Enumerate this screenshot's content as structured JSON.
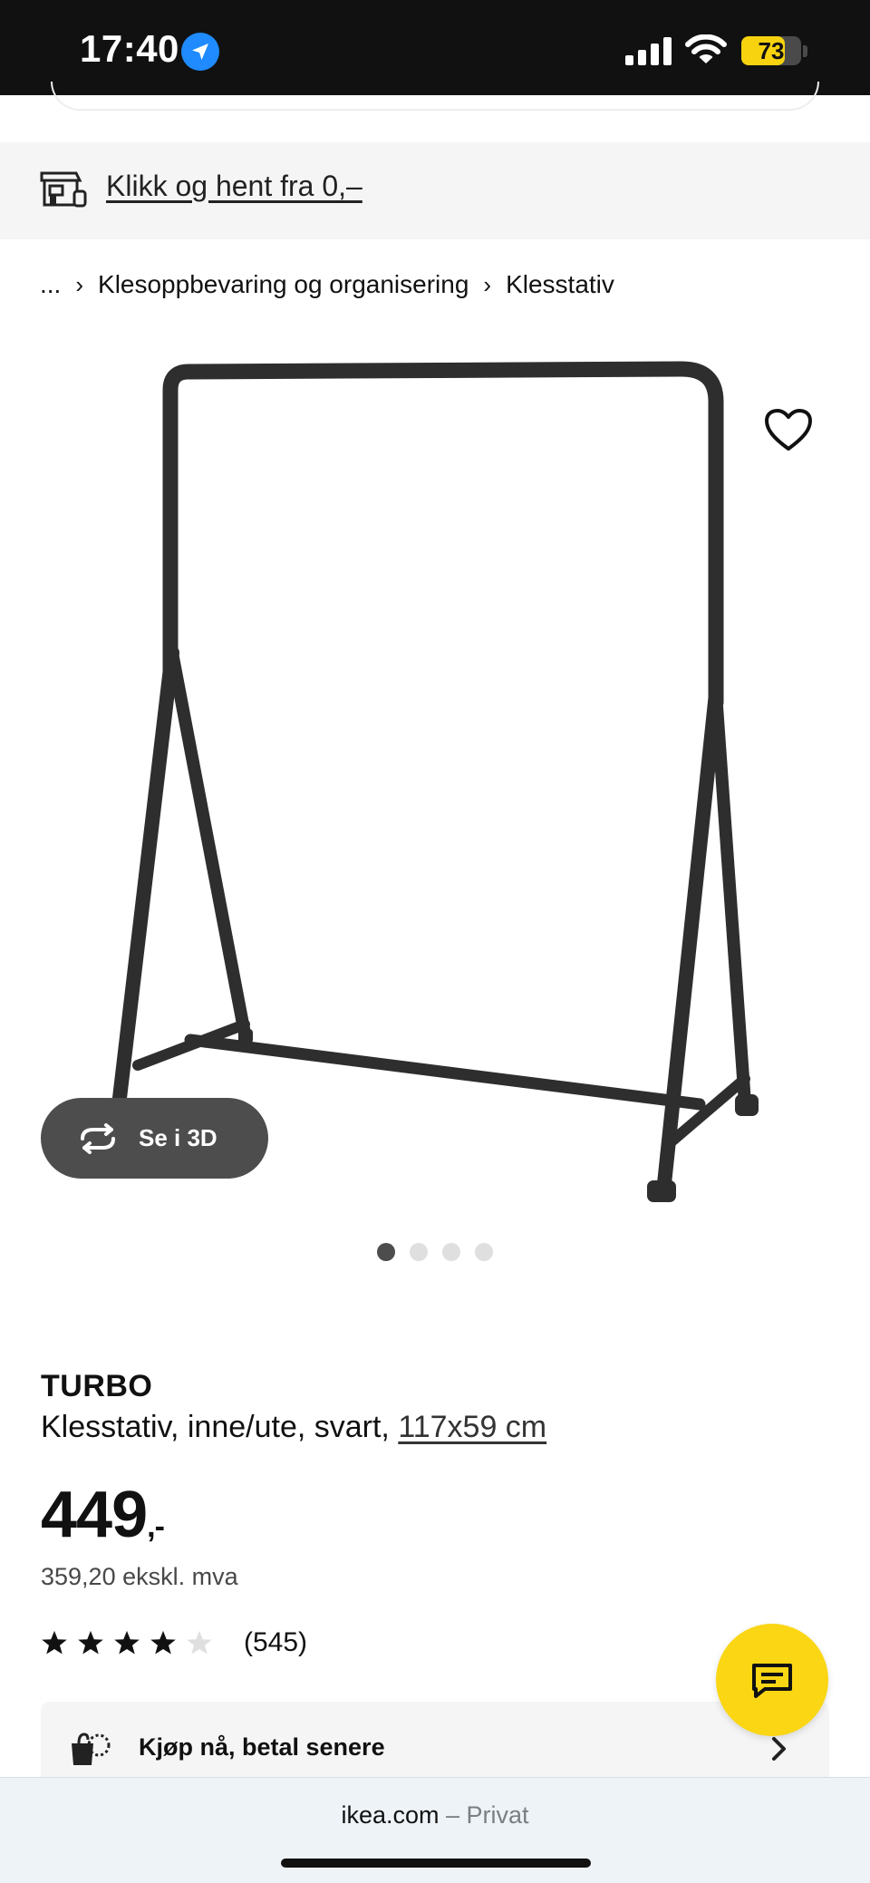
{
  "status_bar": {
    "time": "17:40",
    "battery": "73",
    "battery_level": 0.73,
    "icons": [
      "location-arrow-icon",
      "cellular-signal-icon",
      "wifi-icon",
      "battery-icon"
    ]
  },
  "promo": {
    "icon": "store-pickup-icon",
    "link_text": "Klikk og hent fra 0,–"
  },
  "breadcrumb": {
    "items": [
      "...",
      "Klesoppbevaring og organisering",
      "Klesstativ"
    ]
  },
  "gallery": {
    "favorite_icon": "heart-outline-icon",
    "view_3d_label": "Se i 3D",
    "view_3d_icon": "rotate-3d-icon",
    "image_count": 4,
    "active_index": 0
  },
  "product": {
    "brand": "TURBO",
    "description": "Klesstativ, inne/ute, svart, ",
    "size": "117x59 cm",
    "price": "449",
    "price_suffix": ",-",
    "price_ex_vat": "359,20 ekskl. mva",
    "rating": 4,
    "rating_max": 5,
    "review_count": "(545)"
  },
  "payment": {
    "label": "Kjøp nå, betal senere",
    "icon": "shopping-bag-clock-icon"
  },
  "chat": {
    "icon": "chat-bubble-icon"
  },
  "browser": {
    "domain": "ikea.com",
    "mode": " – Privat"
  },
  "colors": {
    "status_bar_bg": "#111111",
    "location_blue": "#1f8bff",
    "battery_yellow": "#f7d30f",
    "ikea_yellow": "#fad614",
    "banner_bg": "#f5f5f5",
    "button_dark": "#4d4d4d"
  }
}
